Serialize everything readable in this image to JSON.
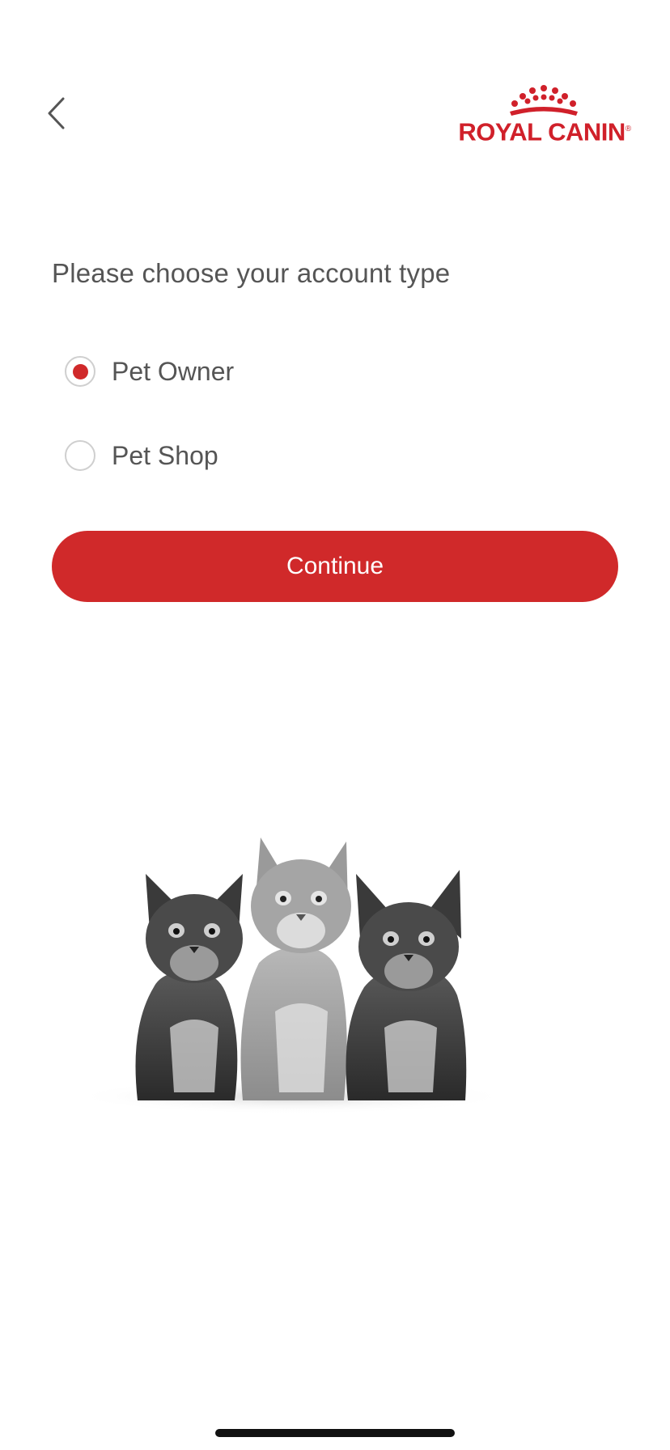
{
  "header": {
    "back_icon": "chevron-left-icon",
    "logo_text": "ROYAL CANIN",
    "logo_registered": "®",
    "brand_color": "#d0202a"
  },
  "form": {
    "prompt": "Please choose your account type",
    "options": [
      {
        "label": "Pet Owner",
        "selected": true
      },
      {
        "label": "Pet Shop",
        "selected": false
      }
    ],
    "continue_label": "Continue",
    "accent_color": "#d0292a"
  },
  "illustration": {
    "icon": "kittens-illustration"
  }
}
